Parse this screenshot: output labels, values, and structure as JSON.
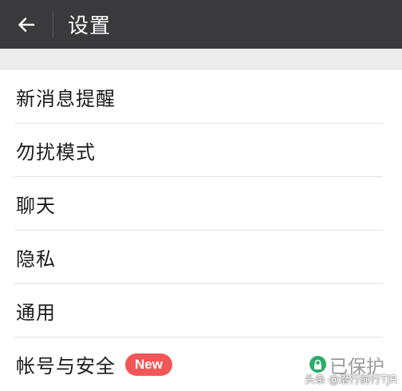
{
  "header": {
    "title": "设置",
    "back_icon": "arrow-left-icon",
    "background": "#3a3a3c"
  },
  "settings": {
    "items": [
      {
        "label": "新消息提醒"
      },
      {
        "label": "勿扰模式"
      },
      {
        "label": "聊天"
      },
      {
        "label": "隐私"
      },
      {
        "label": "通用"
      },
      {
        "label": "帐号与安全",
        "badge": "New",
        "status": "已保护"
      }
    ]
  },
  "colors": {
    "badge": "#f25656",
    "lock": "#2aae67"
  },
  "watermark": "头条 @潜行前行TJR"
}
